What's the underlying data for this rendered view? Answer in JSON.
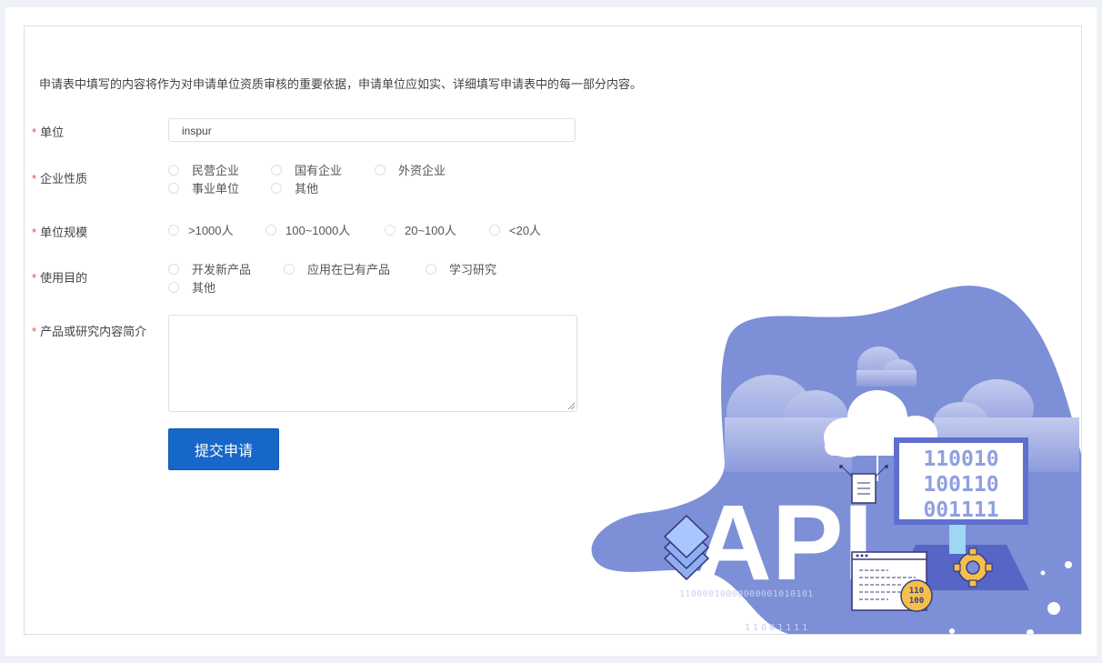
{
  "intro": "申请表中填写的内容将作为对申请单位资质审核的重要依据，申请单位应如实、详细填写申请表中的每一部分内容。",
  "required_mark": "*",
  "form": {
    "unit": {
      "label": "单位",
      "value": "inspur"
    },
    "nature": {
      "label": "企业性质",
      "options": [
        "民营企业",
        "国有企业",
        "外资企业",
        "事业单位",
        "其他"
      ]
    },
    "scale": {
      "label": "单位规模",
      "options": [
        ">1000人",
        "100~1000人",
        "20~100人",
        "<20人"
      ]
    },
    "purpose": {
      "label": "使用目的",
      "options": [
        "开发新产品",
        "应用在已有产品",
        "学习研究",
        "其他"
      ]
    },
    "intro_field": {
      "label": "产品或研究内容简介",
      "value": ""
    },
    "submit_label": "提交申请"
  },
  "illustration": {
    "api_text": "API",
    "monitor_rows": [
      "110010",
      "100110",
      "001111"
    ],
    "binary_line_1": "11000010000000001010101",
    "binary_line_2": "11001111",
    "badge_top": "110",
    "badge_bottom": "100",
    "colors": {
      "blob": "#7d8fd6",
      "blob_light": "#a9b5e6",
      "monitor": "#5f6fd0",
      "gear": "#f5c04a"
    }
  }
}
